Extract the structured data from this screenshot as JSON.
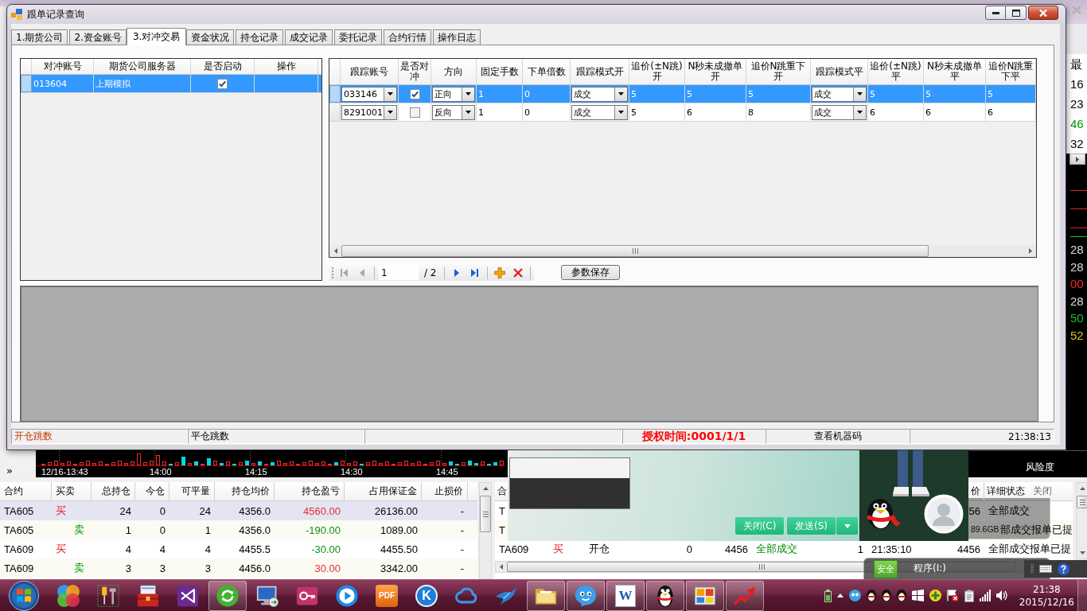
{
  "background_app": {
    "price_column": [
      {
        "text": "最",
        "color": "#000000"
      },
      {
        "text": "16",
        "color": "#000000"
      },
      {
        "text": "23",
        "color": "#000000"
      },
      {
        "text": "46",
        "color": "#009900"
      },
      {
        "text": "32",
        "color": "#000000"
      }
    ],
    "quote_column": [
      {
        "text": "28",
        "color": "#dcdcdc"
      },
      {
        "text": "28",
        "color": "#dcdcdc"
      },
      {
        "text": "00",
        "color": "#ff2020"
      },
      {
        "text": "28",
        "color": "#dcdcdc"
      },
      {
        "text": "50",
        "color": "#20c020"
      },
      {
        "text": "52",
        "color": "#d8c020"
      }
    ],
    "expand_glyph": "»",
    "chart_times": [
      "12/16-13:43",
      "14:00",
      "14:15",
      "14:30",
      "14:45"
    ],
    "risk_label": "风险度",
    "positions": {
      "columns": [
        "合约",
        "买卖",
        "总持仓",
        "今仓",
        "可平量",
        "持仓均价",
        "持仓盈亏",
        "占用保证金",
        "止损价"
      ],
      "rows": [
        {
          "selected": true,
          "cells": [
            {
              "text": "TA605"
            },
            {
              "text": "买",
              "kind": "buy"
            },
            {
              "text": "24"
            },
            {
              "text": "0"
            },
            {
              "text": "24"
            },
            {
              "text": "4356.0"
            },
            {
              "text": "4560.00",
              "color": "#e03030"
            },
            {
              "text": "26136.00"
            },
            {
              "text": "-"
            }
          ]
        },
        {
          "selected": false,
          "cells": [
            {
              "text": "TA605"
            },
            {
              "text": "卖",
              "kind": "sell"
            },
            {
              "text": "1"
            },
            {
              "text": "0"
            },
            {
              "text": "1"
            },
            {
              "text": "4356.0"
            },
            {
              "text": "-190.00",
              "color": "#109010"
            },
            {
              "text": "1089.00"
            },
            {
              "text": "-"
            }
          ]
        },
        {
          "selected": false,
          "cells": [
            {
              "text": "TA609"
            },
            {
              "text": "买",
              "kind": "buy"
            },
            {
              "text": "4"
            },
            {
              "text": "4"
            },
            {
              "text": "4"
            },
            {
              "text": "4455.5"
            },
            {
              "text": "-30.00",
              "color": "#109010"
            },
            {
              "text": "4455.50"
            },
            {
              "text": "-"
            }
          ]
        },
        {
          "selected": false,
          "cells": [
            {
              "text": "TA609"
            },
            {
              "text": "卖",
              "kind": "sell"
            },
            {
              "text": "3"
            },
            {
              "text": "3"
            },
            {
              "text": "3"
            },
            {
              "text": "4456.0"
            },
            {
              "text": "30.00",
              "color": "#e03030"
            },
            {
              "text": "3342.00"
            },
            {
              "text": "-"
            }
          ]
        }
      ]
    },
    "orders": {
      "header": {
        "column_1": "合",
        "column_9": "价",
        "column_10": "详细状态"
      },
      "rows": [
        {
          "column_1": {
            "text": "T"
          },
          "column_9": {
            "text": "56"
          },
          "column_10": {
            "text": "全部成交"
          }
        },
        {
          "column_1": {
            "text": "T"
          },
          "column_10": {
            "text": "部成交报单已提"
          }
        },
        {
          "column_1": {
            "text": "TA609"
          },
          "column_2": {
            "text": "买",
            "kind": "buy"
          },
          "column_3": {
            "text": "开仓"
          },
          "column_4": {
            "text": "0"
          },
          "column_5": {
            "text": "4456"
          },
          "column_6": {
            "text": "全部成交",
            "color": "#008800"
          },
          "column_7": {
            "text": "1"
          },
          "column_8": {
            "text": "21:35:10"
          },
          "column_9": {
            "text": "4456"
          },
          "column_10": {
            "text": "全部成交报单已提"
          }
        }
      ]
    }
  },
  "dialog": {
    "title": "跟单记录查询",
    "tabs": [
      {
        "label": "1.期货公司",
        "selected": false
      },
      {
        "label": "2.资金账号",
        "selected": false
      },
      {
        "label": "3.对冲交易",
        "selected": true
      },
      {
        "label": "资金状况",
        "selected": false
      },
      {
        "label": "持仓记录",
        "selected": false
      },
      {
        "label": "成交记录",
        "selected": false
      },
      {
        "label": "委托记录",
        "selected": false
      },
      {
        "label": "合约行情",
        "selected": false
      },
      {
        "label": "操作日志",
        "selected": false
      }
    ],
    "hedge_accounts": {
      "columns": [
        "对冲账号",
        "期货公司服务器",
        "是否启动",
        "操作"
      ],
      "rows": [
        {
          "selected": true,
          "cells": [
            {
              "kind": "text",
              "value": "013604"
            },
            {
              "kind": "text",
              "value": "上期模拟"
            },
            {
              "kind": "check",
              "checked": true
            },
            {
              "kind": "blank"
            }
          ]
        }
      ]
    },
    "follow_accounts": {
      "columns": [
        "跟踪账号",
        "是否对冲",
        "方向",
        "固定手数",
        "下单倍数",
        "跟踪模式开",
        "追价(±N跳)开",
        "N秒未成撤单开",
        "追价N跳重下开",
        "跟踪模式平",
        "追价(±N跳)平",
        "N秒未成撤单平",
        "追价N跳重下平"
      ],
      "rows": [
        {
          "selected": true,
          "cells": [
            {
              "kind": "combo",
              "value": "033146"
            },
            {
              "kind": "check",
              "checked": true
            },
            {
              "kind": "combo",
              "value": "正向"
            },
            {
              "kind": "text",
              "value": "1"
            },
            {
              "kind": "text",
              "value": "0"
            },
            {
              "kind": "combo",
              "value": "成交"
            },
            {
              "kind": "text",
              "value": "5"
            },
            {
              "kind": "text",
              "value": "5"
            },
            {
              "kind": "text",
              "value": "5"
            },
            {
              "kind": "combo",
              "value": "成交"
            },
            {
              "kind": "text",
              "value": "5"
            },
            {
              "kind": "text",
              "value": "5"
            },
            {
              "kind": "text",
              "value": "5"
            }
          ]
        },
        {
          "selected": false,
          "cells": [
            {
              "kind": "combo",
              "value": "8291001"
            },
            {
              "kind": "check",
              "checked": false
            },
            {
              "kind": "combo",
              "value": "反向"
            },
            {
              "kind": "text",
              "value": "1"
            },
            {
              "kind": "text",
              "value": "0"
            },
            {
              "kind": "combo",
              "value": "成交"
            },
            {
              "kind": "text",
              "value": "5"
            },
            {
              "kind": "text",
              "value": "6"
            },
            {
              "kind": "text",
              "value": "8"
            },
            {
              "kind": "combo",
              "value": "成交"
            },
            {
              "kind": "text",
              "value": "6"
            },
            {
              "kind": "text",
              "value": "6"
            },
            {
              "kind": "text",
              "value": "6"
            }
          ]
        }
      ]
    },
    "pager": {
      "buttons": [
        {
          "disabled": true
        },
        {
          "disabled": true
        },
        {
          "disabled": false
        },
        {
          "disabled": false
        },
        {
          "disabled": false
        },
        {
          "disabled": false
        }
      ],
      "page": "1",
      "total": "/ 2"
    },
    "save_button": "参数保存",
    "status_bar": [
      {
        "kind": "accent",
        "text": "开仓跳数"
      },
      {
        "kind": "text",
        "text": "平仓跳数"
      },
      {
        "kind": "blank"
      },
      {
        "kind": "alert",
        "text": "授权时间:0001/1/1"
      },
      {
        "kind": "button",
        "text": "查看机器码"
      },
      {
        "kind": "clock",
        "text": "21:38:13"
      }
    ]
  },
  "popups": {
    "chat": {
      "buttons": [
        "关闭(C)",
        "发送(S)"
      ]
    },
    "close_link": "关闭",
    "disk": {
      "size": "89.6GB",
      "badge": "安全",
      "drive": "程序(I:)"
    }
  },
  "taskbar": {
    "apps": [
      {
        "running": false
      },
      {
        "running": false
      },
      {
        "running": false
      },
      {
        "running": false
      },
      {
        "running": true
      },
      {
        "running": false
      },
      {
        "running": false
      },
      {
        "running": false
      },
      {
        "running": false,
        "label": "PDF"
      },
      {
        "running": false,
        "label": "K"
      },
      {
        "running": false
      },
      {
        "running": false
      },
      {
        "running": true
      },
      {
        "running": true
      },
      {
        "running": true,
        "label": "W"
      },
      {
        "running": true
      },
      {
        "running": true
      },
      {
        "running": true
      }
    ],
    "clock": {
      "time": "21:38",
      "date": "2015/12/16"
    }
  }
}
